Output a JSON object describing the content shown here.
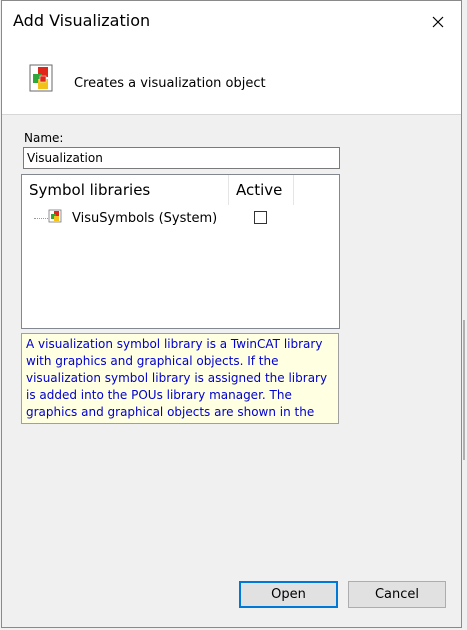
{
  "dialog": {
    "title": "Add Visualization",
    "subtitle": "Creates a visualization object"
  },
  "name_field": {
    "label": "Name:",
    "value": "Visualization"
  },
  "symbol_list": {
    "columns": [
      "Symbol libraries",
      "Active"
    ],
    "rows": [
      {
        "label": "VisuSymbols (System)",
        "active": false
      }
    ]
  },
  "info_text": "A visualization symbol library is a TwinCAT library with graphics and graphical objects. If the visualization symbol library is assigned the library is added into the POUs library manager. The graphics and graphical objects are shown in the",
  "buttons": {
    "open": "Open",
    "cancel": "Cancel"
  },
  "icons": {
    "close": "close-icon",
    "header": "visualization-icon",
    "row": "symbol-library-icon"
  },
  "colors": {
    "info_text": "#0000d0",
    "info_bg": "#ffffe1",
    "default_button_border": "#0078d7"
  }
}
